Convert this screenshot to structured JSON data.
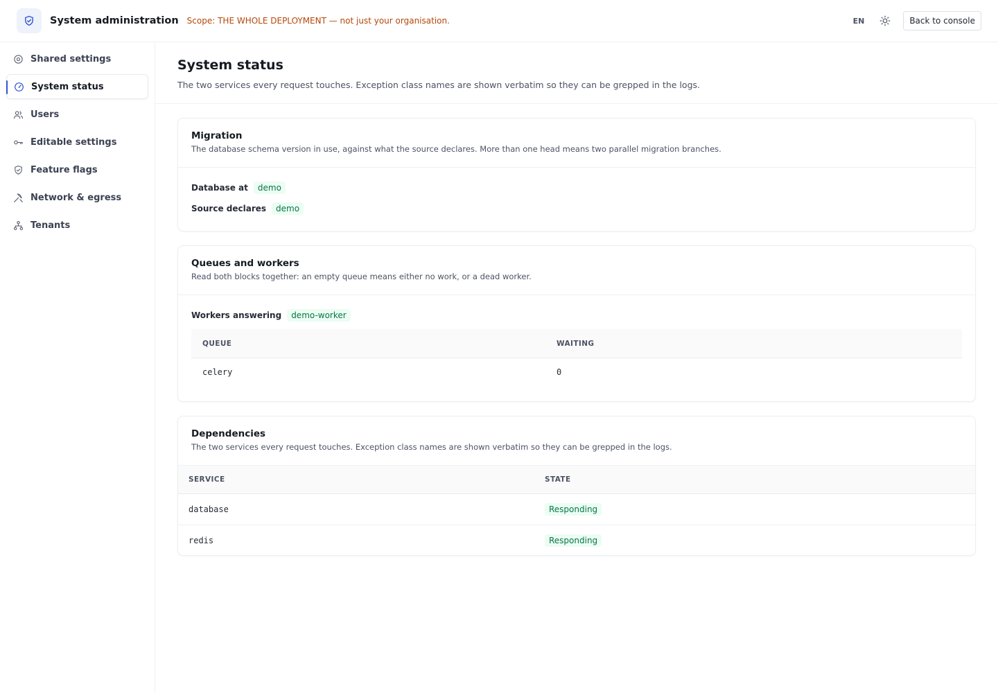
{
  "header": {
    "title": "System administration",
    "scope": "Scope: THE WHOLE DEPLOYMENT — not just your organisation.",
    "lang": "EN",
    "back_label": "Back to console",
    "brand_icon": "shield-check-icon",
    "theme_icon": "sun-icon"
  },
  "sidebar": {
    "items": [
      {
        "label": "Shared settings",
        "icon": "gear-icon"
      },
      {
        "label": "System status",
        "icon": "gauge-icon",
        "active": true
      },
      {
        "label": "Users",
        "icon": "users-icon"
      },
      {
        "label": "Editable settings",
        "icon": "key-icon"
      },
      {
        "label": "Feature flags",
        "icon": "shield-icon"
      },
      {
        "label": "Network & egress",
        "icon": "network-icon"
      },
      {
        "label": "Tenants",
        "icon": "sitemap-icon"
      }
    ]
  },
  "page": {
    "title": "System status",
    "subtitle": "The two services every request touches. Exception class names are shown verbatim so they can be grepped in the logs."
  },
  "migration": {
    "title": "Migration",
    "subtitle": "The database schema version in use, against what the source declares. More than one head means two parallel migration branches.",
    "db_label": "Database at",
    "db_value": "demo",
    "src_label": "Source declares",
    "src_value": "demo"
  },
  "queues": {
    "title": "Queues and workers",
    "subtitle": "Read both blocks together: an empty queue means either no work, or a dead worker.",
    "workers_label": "Workers answering",
    "workers_value": "demo-worker",
    "columns": [
      "QUEUE",
      "WAITING"
    ],
    "rows": [
      {
        "queue": "celery",
        "waiting": "0"
      }
    ]
  },
  "dependencies": {
    "title": "Dependencies",
    "subtitle": "The two services every request touches. Exception class names are shown verbatim so they can be grepped in the logs.",
    "columns": [
      "SERVICE",
      "STATE"
    ],
    "rows": [
      {
        "service": "database",
        "state": "Responding"
      },
      {
        "service": "redis",
        "state": "Responding"
      }
    ]
  },
  "colors": {
    "accent": "#2f53d6",
    "warning": "#b54708",
    "success_text": "#067647",
    "success_bg": "#ecfdf3"
  }
}
